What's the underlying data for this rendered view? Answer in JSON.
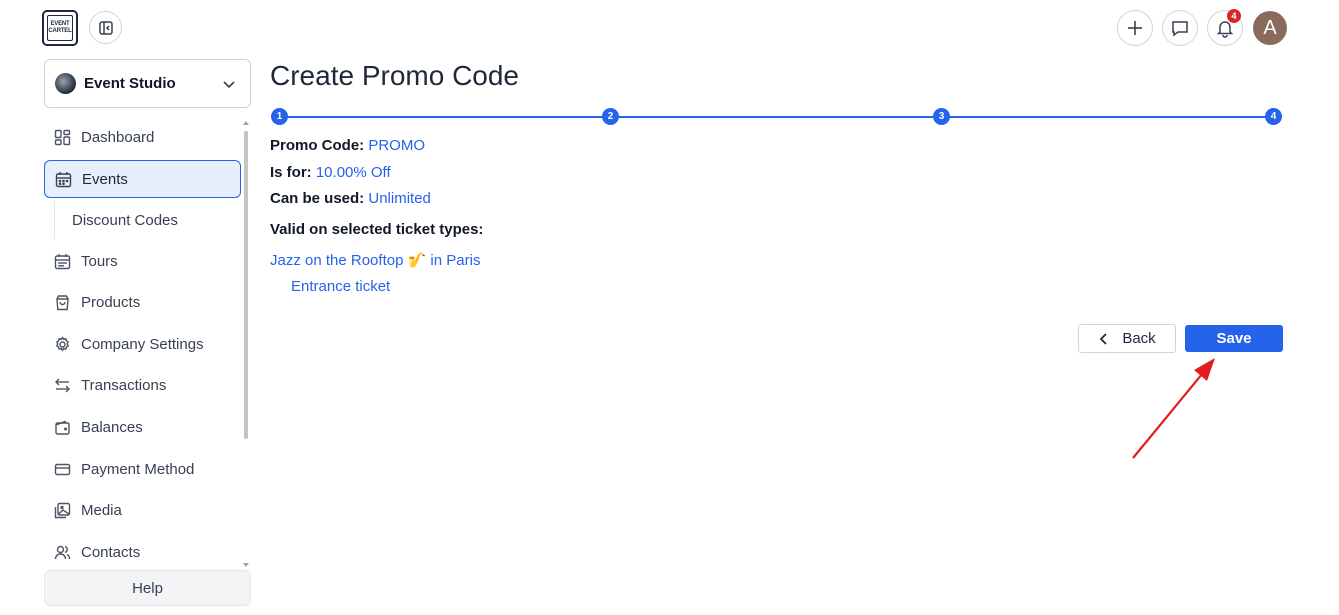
{
  "header": {
    "logo_line1": "EVENT",
    "logo_line2": "CARTEL",
    "notification_count": "4",
    "avatar_initial": "A"
  },
  "sidebar": {
    "studio_name": "Event Studio",
    "items": [
      {
        "label": "Dashboard",
        "icon": "dashboard-icon"
      },
      {
        "label": "Events",
        "icon": "calendar-icon",
        "active": true
      },
      {
        "label": "Discount Codes",
        "sub": true
      },
      {
        "label": "Tours",
        "icon": "calendar-icon"
      },
      {
        "label": "Products",
        "icon": "bag-icon"
      },
      {
        "label": "Company Settings",
        "icon": "gear-icon"
      },
      {
        "label": "Transactions",
        "icon": "transfer-icon"
      },
      {
        "label": "Balances",
        "icon": "wallet-icon"
      },
      {
        "label": "Payment Method",
        "icon": "credit-card-icon"
      },
      {
        "label": "Media",
        "icon": "images-icon"
      },
      {
        "label": "Contacts",
        "icon": "users-icon"
      }
    ],
    "help_label": "Help"
  },
  "main": {
    "title": "Create Promo Code",
    "steps": [
      "1",
      "2",
      "3",
      "4"
    ],
    "promo_code_label": "Promo Code:",
    "promo_code_value": "PROMO",
    "is_for_label": "Is for:",
    "is_for_value": "10.00% Off",
    "can_be_used_label": "Can be used:",
    "can_be_used_value": "Unlimited",
    "valid_label": "Valid on selected ticket types:",
    "event_link": "Jazz on the Rooftop 🎷 in Paris",
    "ticket_link": "Entrance ticket",
    "back_label": "Back",
    "save_label": "Save"
  },
  "colors": {
    "accent": "#2563eb",
    "badge": "#dc2626",
    "annotation_arrow": "#e11d1d"
  }
}
